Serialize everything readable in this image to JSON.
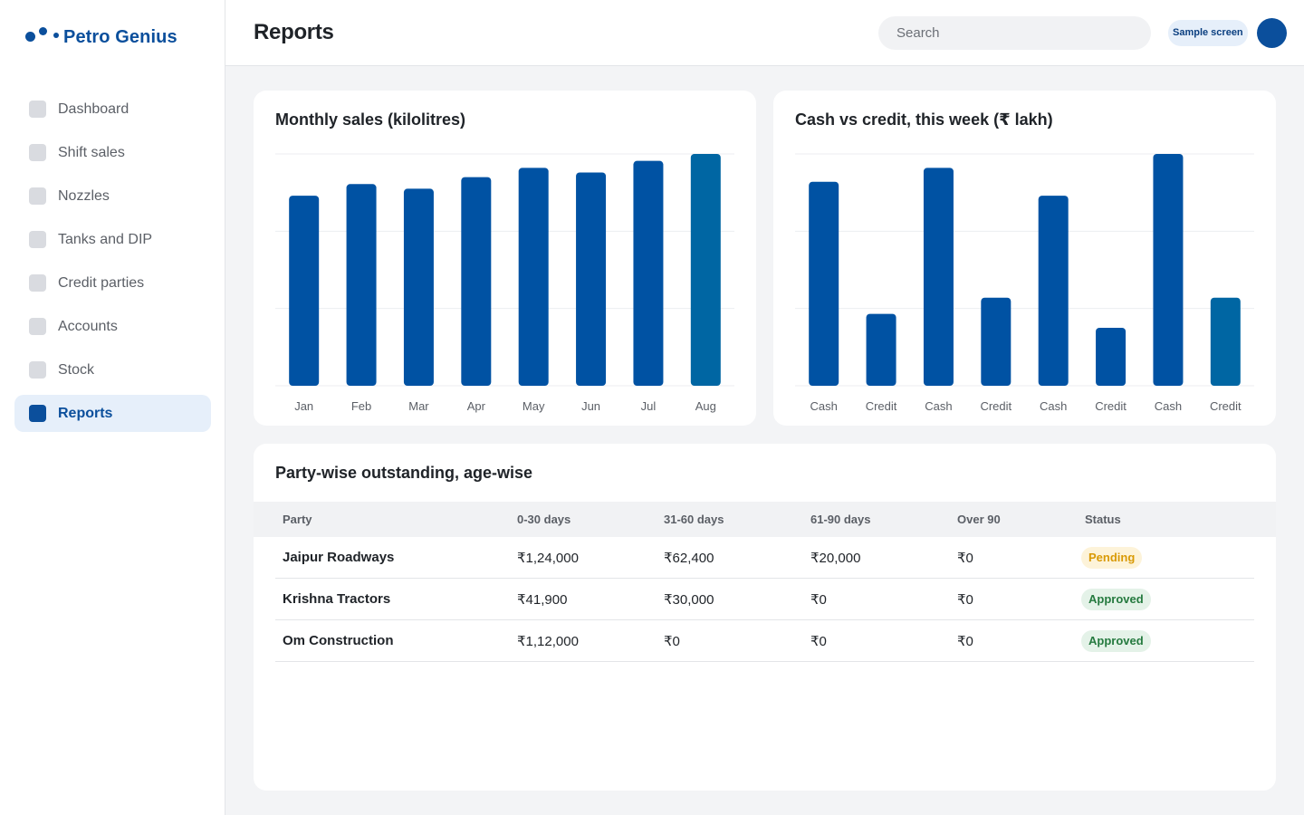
{
  "app": {
    "name": "Petro Genius"
  },
  "sidebar": {
    "items": [
      {
        "label": "Dashboard",
        "active": false
      },
      {
        "label": "Shift sales",
        "active": false
      },
      {
        "label": "Nozzles",
        "active": false
      },
      {
        "label": "Tanks and DIP",
        "active": false
      },
      {
        "label": "Credit parties",
        "active": false
      },
      {
        "label": "Accounts",
        "active": false
      },
      {
        "label": "Stock",
        "active": false
      },
      {
        "label": "Reports",
        "active": true
      }
    ]
  },
  "header": {
    "title": "Reports",
    "search_placeholder": "Search",
    "badge": "Sample screen"
  },
  "colors": {
    "brand": "#0b4f9c",
    "bar": "#0052a3",
    "bar_highlight": "#0066a3",
    "pending": "#d99a06",
    "approved": "#257a3f"
  },
  "chart_data": [
    {
      "type": "bar",
      "title": "Monthly sales (kilolitres)",
      "categories": [
        "Jan",
        "Feb",
        "Mar",
        "Apr",
        "May",
        "Jun",
        "Jul",
        "Aug"
      ],
      "values": [
        82,
        87,
        85,
        90,
        94,
        92,
        97,
        100
      ],
      "ylim": [
        0,
        100
      ],
      "highlight_index": 7,
      "grid": true
    },
    {
      "type": "bar",
      "title": "Cash vs credit, this week (₹ lakh)",
      "categories": [
        "Cash",
        "Credit",
        "Cash",
        "Credit",
        "Cash",
        "Credit",
        "Cash",
        "Credit"
      ],
      "values": [
        88,
        31,
        94,
        38,
        82,
        25,
        100,
        38
      ],
      "ylim": [
        0,
        100
      ],
      "highlight_index": 7,
      "grid": true
    }
  ],
  "outstanding": {
    "title": "Party-wise outstanding, age-wise",
    "columns": [
      "Party",
      "0-30 days",
      "31-60 days",
      "61-90 days",
      "Over 90",
      "Status"
    ],
    "rows": [
      {
        "party": "Jaipur Roadways",
        "d0_30": "₹1,24,000",
        "d31_60": "₹62,400",
        "d61_90": "₹20,000",
        "over90": "₹0",
        "status": "Pending",
        "status_kind": "pending"
      },
      {
        "party": "Krishna Tractors",
        "d0_30": "₹41,900",
        "d31_60": "₹30,000",
        "d61_90": "₹0",
        "over90": "₹0",
        "status": "Approved",
        "status_kind": "approved"
      },
      {
        "party": "Om Construction",
        "d0_30": "₹1,12,000",
        "d31_60": "₹0",
        "d61_90": "₹0",
        "over90": "₹0",
        "status": "Approved",
        "status_kind": "approved"
      }
    ]
  }
}
